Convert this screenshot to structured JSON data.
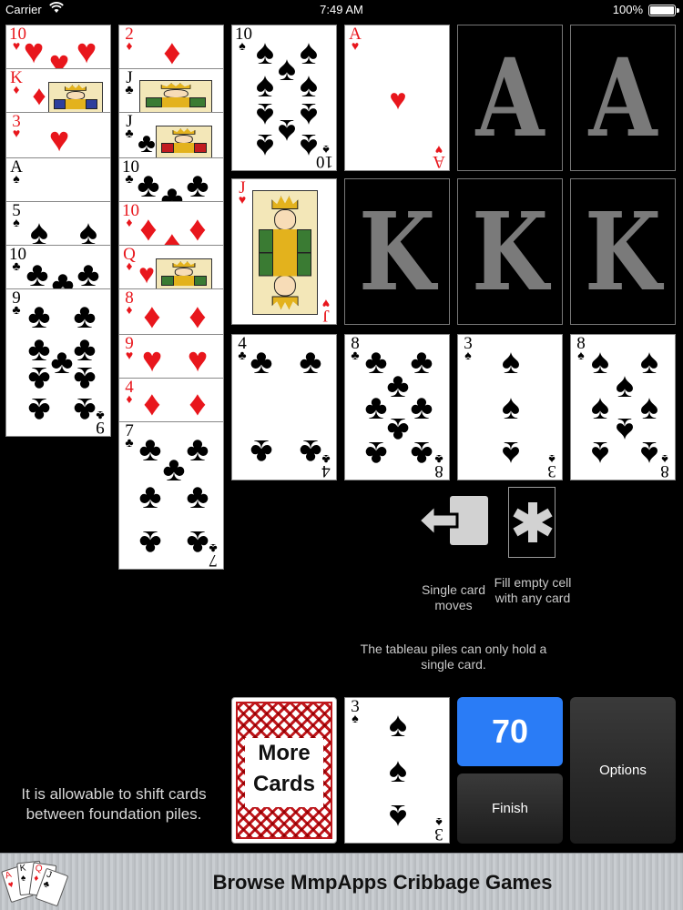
{
  "status_bar": {
    "carrier": "Carrier",
    "time": "7:49 AM",
    "battery": "100%",
    "battery_level": 1.0
  },
  "suits": {
    "hearts": "♥",
    "diamonds": "♦",
    "clubs": "♣",
    "spades": "♠"
  },
  "tableau_col1": [
    {
      "rank": "10",
      "suit": "hearts"
    },
    {
      "rank": "K",
      "suit": "diamonds"
    },
    {
      "rank": "3",
      "suit": "hearts"
    },
    {
      "rank": "A",
      "suit": "spades"
    },
    {
      "rank": "5",
      "suit": "spades"
    },
    {
      "rank": "10",
      "suit": "clubs"
    },
    {
      "rank": "9",
      "suit": "clubs"
    }
  ],
  "tableau_col2": [
    {
      "rank": "2",
      "suit": "diamonds"
    },
    {
      "rank": "J",
      "suit": "clubs"
    },
    {
      "rank": "J",
      "suit": "clubs"
    },
    {
      "rank": "10",
      "suit": "clubs"
    },
    {
      "rank": "10",
      "suit": "diamonds"
    },
    {
      "rank": "Q",
      "suit": "diamonds"
    },
    {
      "rank": "8",
      "suit": "diamonds"
    },
    {
      "rank": "9",
      "suit": "hearts"
    },
    {
      "rank": "4",
      "suit": "diamonds"
    },
    {
      "rank": "7",
      "suit": "clubs"
    }
  ],
  "grid_cards": {
    "ten_spades": {
      "rank": "10",
      "suit": "spades"
    },
    "ace_hearts": {
      "rank": "A",
      "suit": "hearts"
    },
    "jack_hearts": {
      "rank": "J",
      "suit": "hearts"
    },
    "four_clubs": {
      "rank": "4",
      "suit": "clubs"
    },
    "eight_clubs": {
      "rank": "8",
      "suit": "clubs"
    },
    "three_spades": {
      "rank": "3",
      "suit": "spades"
    },
    "eight_spades": {
      "rank": "8",
      "suit": "spades"
    }
  },
  "foundation_slots": {
    "ace_1": "A",
    "ace_2": "A",
    "king_1": "K",
    "king_2": "K",
    "king_3": "K"
  },
  "hints": {
    "single_card_moves": "Single card moves",
    "fill_empty_cell": "Fill empty cell with any card",
    "tableau_rule": "The tableau piles can only hold a single card.",
    "shift_rule": "It is allowable to shift cards between foundation piles."
  },
  "stock": {
    "label_line1": "More",
    "label_line2": "Cards"
  },
  "waste_card": {
    "rank": "3",
    "suit": "spades"
  },
  "score": "70",
  "buttons": {
    "finish": "Finish",
    "options": "Options"
  },
  "banner": {
    "text": "Browse MmpApps Cribbage Games"
  },
  "colors": {
    "red_suit": "#e8161c",
    "score_blue": "#2a7cf6",
    "background": "#000000"
  }
}
